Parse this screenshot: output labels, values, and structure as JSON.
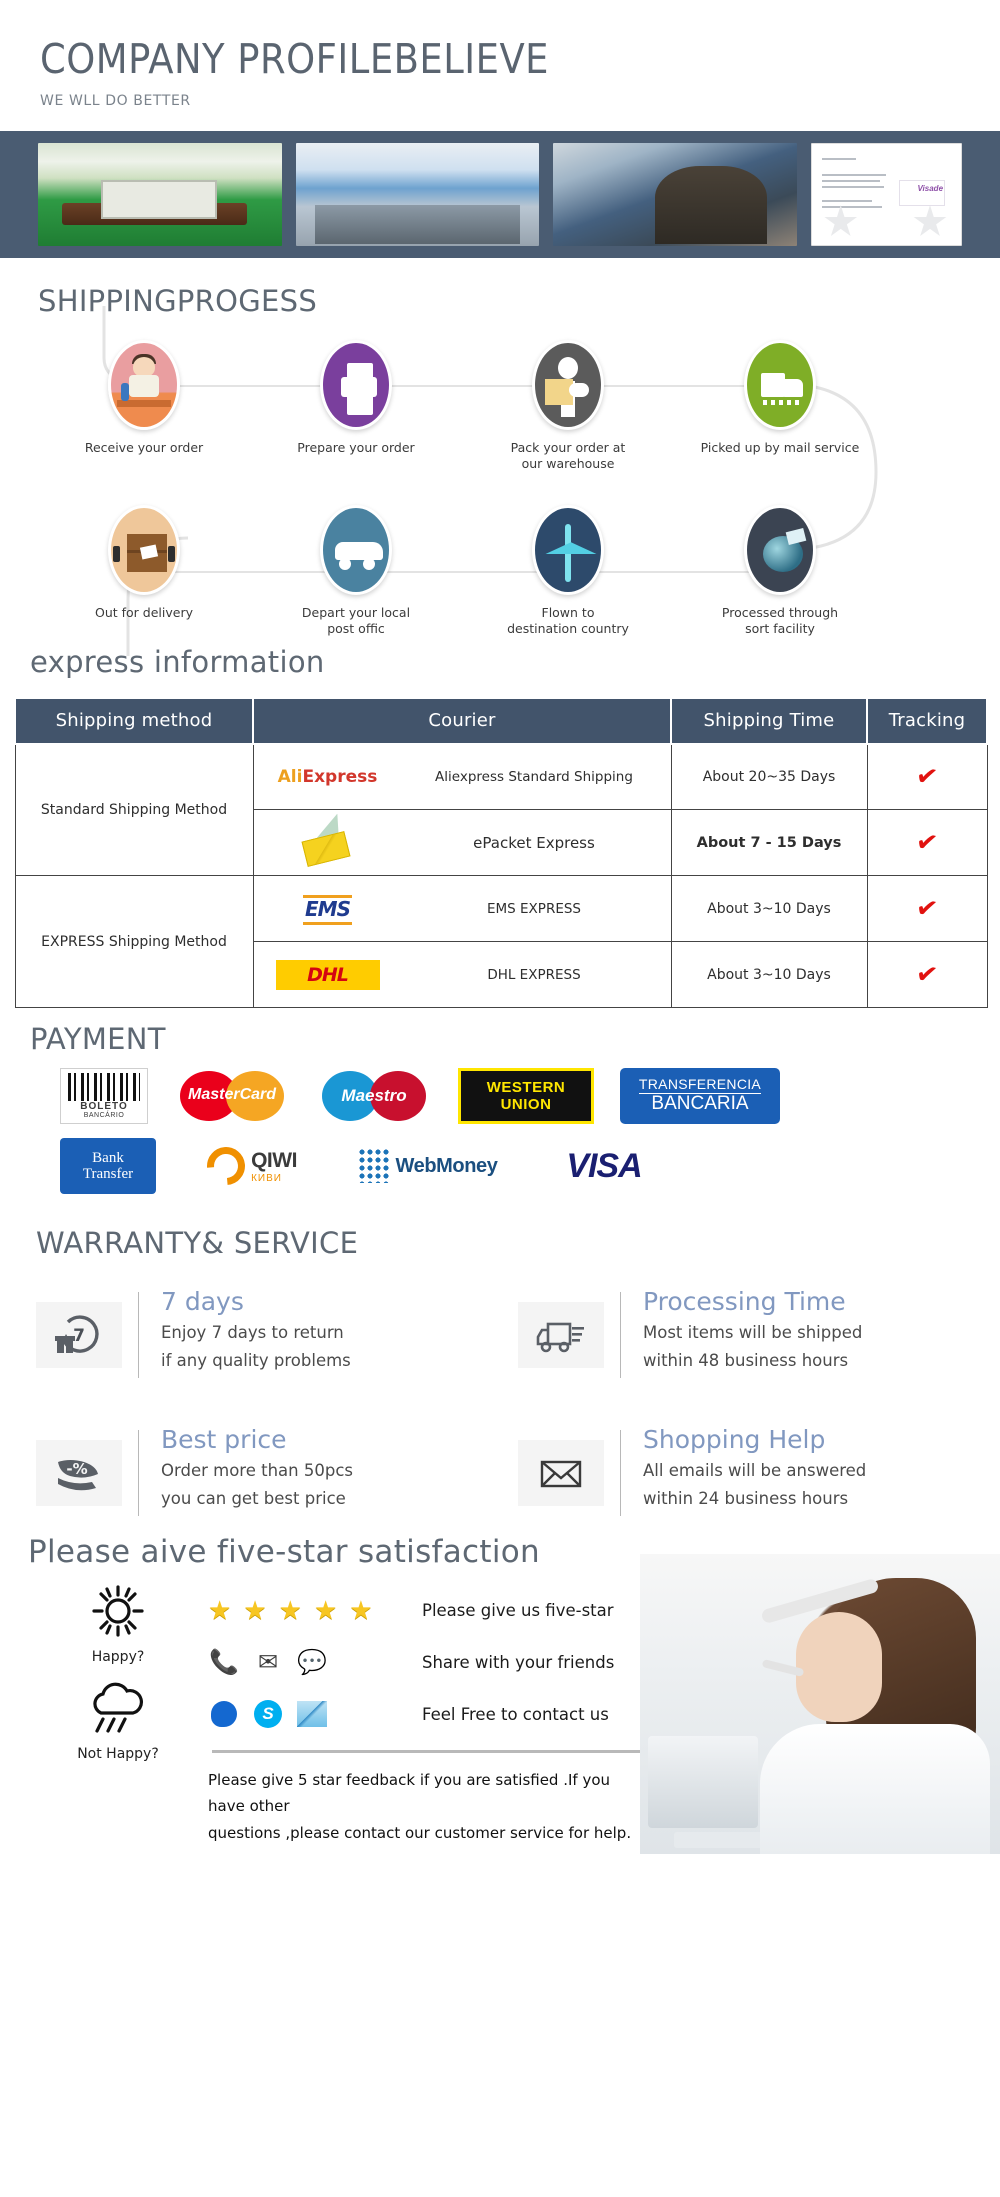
{
  "header": {
    "title": "COMPANY PROFILEBELIEVE",
    "subtitle": "WE WLL DO BETTER"
  },
  "banner": {
    "photos": [
      {
        "alt": "showroom-photo"
      },
      {
        "alt": "office-photo"
      },
      {
        "alt": "production-line-photo"
      },
      {
        "alt": "certificate-photo"
      }
    ]
  },
  "shipping_progress": {
    "title": "SHIPPINGPROGESS",
    "steps": [
      {
        "icon": "person-receiving-order-icon",
        "label": "Receive your order"
      },
      {
        "icon": "printer-icon",
        "label": "Prepare your order"
      },
      {
        "icon": "worker-packing-icon",
        "label": "Pack your order at\nour warehouse"
      },
      {
        "icon": "truck-icon",
        "label": "Picked up by mail service"
      },
      {
        "icon": "package-box-icon",
        "label": "Out for delivery"
      },
      {
        "icon": "van-icon",
        "label": "Depart your local\npost offic"
      },
      {
        "icon": "airplane-icon",
        "label": "Flown to\ndestination country"
      },
      {
        "icon": "globe-sorting-icon",
        "label": "Processed through\nsort facility"
      }
    ]
  },
  "express": {
    "title": "express information",
    "columns": [
      "Shipping method",
      "Courier",
      "Shipping Time",
      "Tracking"
    ],
    "groups": [
      {
        "method": "Standard Shipping Method",
        "rows": [
          {
            "logo": "aliexpress-logo",
            "courier": "Aliexpress Standard Shipping",
            "time": "About 20~35 Days",
            "time_bold": false,
            "tracking": "check-icon"
          },
          {
            "logo": "epacket-logo",
            "courier": "ePacket Express",
            "time": "About 7 - 15 Days",
            "time_bold": true,
            "tracking": "check-icon"
          }
        ]
      },
      {
        "method": "EXPRESS Shipping Method",
        "rows": [
          {
            "logo": "ems-logo",
            "courier": "EMS EXPRESS",
            "time": "About 3~10 Days",
            "time_bold": false,
            "tracking": "check-icon"
          },
          {
            "logo": "dhl-logo",
            "courier": "DHL EXPRESS",
            "time": "About 3~10 Days",
            "time_bold": false,
            "tracking": "check-icon"
          }
        ]
      }
    ]
  },
  "payment": {
    "title": "PAYMENT",
    "row1": [
      {
        "name": "boleto-bancario-logo",
        "line1": "BOLETO",
        "line2": "BANCÁRIO"
      },
      {
        "name": "mastercard-logo",
        "text": "MasterCard"
      },
      {
        "name": "maestro-logo",
        "text": "Maestro"
      },
      {
        "name": "western-union-logo",
        "line1": "WESTERN",
        "line2": "UNION"
      },
      {
        "name": "transferencia-bancaria-logo",
        "line1": "TRANSFERENCIA",
        "line2": "BANCARIA"
      }
    ],
    "row2": [
      {
        "name": "bank-transfer-logo",
        "line1": "Bank",
        "line2": "Transfer"
      },
      {
        "name": "qiwi-logo",
        "text": "QIWI",
        "sub": "КИВИ"
      },
      {
        "name": "webmoney-logo",
        "text": "WebMoney"
      },
      {
        "name": "visa-logo",
        "text": "VISA"
      }
    ]
  },
  "warranty": {
    "title": "WARRANTY& SERVICE",
    "items": [
      {
        "icon": "seven-day-return-icon",
        "heading": "7 days",
        "line1": "Enjoy 7 days to return",
        "line2": "if any quality problems"
      },
      {
        "icon": "delivery-truck-icon",
        "heading": "Processing Time",
        "line1": "Most items will be shipped",
        "line2": "within 48 business hours"
      },
      {
        "icon": "discount-tag-icon",
        "heading": "Best price",
        "line1": "Order more than 50pcs",
        "line2": "you can get best price"
      },
      {
        "icon": "envelope-icon",
        "heading": "Shopping Help",
        "line1": "All emails will be answered",
        "line2": "within 24 business hours"
      }
    ],
    "accent_color": "#8198c0"
  },
  "five_star": {
    "title": "Please aive five-star satisfaction",
    "moods": [
      {
        "icon": "sun-icon",
        "label": "Happy?"
      },
      {
        "icon": "rain-cloud-icon",
        "label": "Not Happy?"
      }
    ],
    "rows": [
      {
        "icons": [
          "star-icon",
          "star-icon",
          "star-icon",
          "star-icon",
          "star-icon"
        ],
        "label": "Please give us five-star"
      },
      {
        "icons": [
          "phone-icon",
          "mail-icon",
          "chat-icon"
        ],
        "label": "Share with your friends"
      },
      {
        "icons": [
          "messenger-icon",
          "skype-icon",
          "email-icon"
        ],
        "label": "Feel Free to contact us"
      }
    ],
    "note_line1": "Please give 5 star feedback if you are satisfied .If you have other",
    "note_line2": "questions ,please contact our customer service for help.",
    "agent_image": "customer-service-agent-photo"
  },
  "colors": {
    "banner_bg": "#4a5c72",
    "table_header_bg": "#42546b",
    "heading_gray": "#5e6873",
    "accent_blue": "#8198c0",
    "tracking_red": "#e1120f"
  }
}
